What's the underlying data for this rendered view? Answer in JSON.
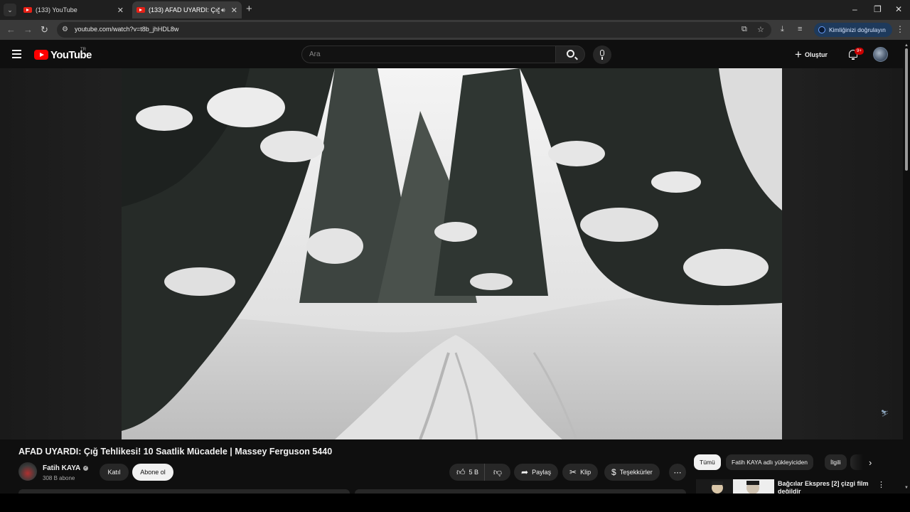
{
  "browser": {
    "tabs": [
      {
        "title": "(133) YouTube",
        "active": false
      },
      {
        "title": "(133) AFAD UYARDI: Çığ Tehlikesi! 10 Saatlik Mücadele | Massey Ferguson 5440",
        "active": true
      }
    ],
    "url": "youtube.com/watch?v=t8b_jhHDL8w",
    "verify_label": "Kimliğinizi doğrulayın"
  },
  "youtube": {
    "logo_text": "YouTube",
    "region": "TR",
    "search_placeholder": "Ara",
    "create_label": "Oluştur",
    "notification_badge": "9+"
  },
  "video": {
    "title": "AFAD UYARDI: Çığ Tehlikesi! 10 Saatlik Mücadele | Massey Ferguson 5440",
    "channel": "Fatih KAYA",
    "subscribers": "308 B abone",
    "join_label": "Katıl",
    "subscribe_label": "Abone ol",
    "likes": "5 B",
    "share_label": "Paylaş",
    "clip_label": "Klip",
    "thanks_label": "Teşekkürler"
  },
  "sidebar": {
    "chips": [
      "Tümü",
      "Fatih KAYA adlı yükleyiciden",
      "İlgili"
    ],
    "recommendation": {
      "title": "Bağcılar Ekspres [2] çizgi film değildir"
    }
  },
  "colors": {
    "background": "#0f0f0f",
    "brand_red": "#ff0000",
    "verify_pill": "#1e3a5c"
  }
}
